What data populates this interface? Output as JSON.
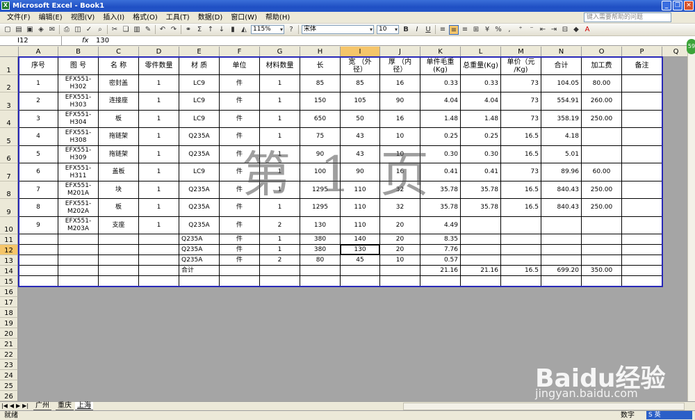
{
  "window": {
    "title": "Microsoft Excel - Book1"
  },
  "menu": {
    "items": [
      "文件(F)",
      "编辑(E)",
      "视图(V)",
      "插入(I)",
      "格式(O)",
      "工具(T)",
      "数据(D)",
      "窗口(W)",
      "帮助(H)"
    ],
    "help_placeholder": "键入需要帮助的问题"
  },
  "toolbar": {
    "zoom": "115%",
    "font": "宋体",
    "size": "10"
  },
  "formula_bar": {
    "cell_ref": "I12",
    "fx": "fx",
    "value": "130"
  },
  "columns": [
    "A",
    "B",
    "C",
    "D",
    "E",
    "F",
    "G",
    "H",
    "I",
    "J",
    "K",
    "L",
    "M",
    "N",
    "O",
    "P",
    "Q"
  ],
  "selected_column": "I",
  "rows": [
    "1",
    "2",
    "3",
    "4",
    "5",
    "6",
    "7",
    "8",
    "9",
    "10",
    "11",
    "12",
    "13",
    "14",
    "15",
    "16",
    "17",
    "18",
    "19",
    "20",
    "21",
    "22",
    "23",
    "24",
    "25",
    "26"
  ],
  "selected_row": "12",
  "table": {
    "headers": [
      "序号",
      "图 号",
      "名 称",
      "零件数量",
      "材 质",
      "单位",
      "材料数量",
      "长",
      "宽  （外\n径）",
      "厚  （内\n径）",
      "单件毛重\n(Kg)",
      "总重量(Kg)",
      "单价（元\n/Kg)",
      "合计",
      "加工费",
      "备注"
    ],
    "rows": [
      [
        "1",
        "EFX551-\nH302",
        "密封盖",
        "1",
        "LC9",
        "件",
        "1",
        "85",
        "85",
        "16",
        "0.33",
        "0.33",
        "73",
        "104.05",
        "80.00",
        ""
      ],
      [
        "2",
        "EFX551-\nH303",
        "连接座",
        "1",
        "LC9",
        "件",
        "1",
        "150",
        "105",
        "90",
        "4.04",
        "4.04",
        "73",
        "554.91",
        "260.00",
        ""
      ],
      [
        "3",
        "EFX551-\nH304",
        "板",
        "1",
        "LC9",
        "件",
        "1",
        "650",
        "50",
        "16",
        "1.48",
        "1.48",
        "73",
        "358.19",
        "250.00",
        ""
      ],
      [
        "4",
        "EFX551-\nH308",
        "拖链架",
        "1",
        "Q235A",
        "件",
        "1",
        "75",
        "43",
        "10",
        "0.25",
        "0.25",
        "16.5",
        "4.18",
        "",
        ""
      ],
      [
        "5",
        "EFX551-\nH309",
        "拖链架",
        "1",
        "Q235A",
        "件",
        "1",
        "90",
        "43",
        "10",
        "0.30",
        "0.30",
        "16.5",
        "5.01",
        "",
        ""
      ],
      [
        "6",
        "EFX551-\nH311",
        "盖板",
        "1",
        "LC9",
        "件",
        "1",
        "100",
        "90",
        "16",
        "0.41",
        "0.41",
        "73",
        "89.96",
        "60.00",
        ""
      ],
      [
        "7",
        "EFX551-\nM201A",
        "块",
        "1",
        "Q235A",
        "件",
        "1",
        "1295",
        "110",
        "32",
        "35.78",
        "35.78",
        "16.5",
        "840.43",
        "250.00",
        ""
      ],
      [
        "8",
        "EFX551-\nM202A",
        "板",
        "1",
        "Q235A",
        "件",
        "1",
        "1295",
        "110",
        "32",
        "35.78",
        "35.78",
        "16.5",
        "840.43",
        "250.00",
        ""
      ],
      [
        "9",
        "EFX551-\nM203A",
        "支座",
        "1",
        "Q235A",
        "件",
        "2",
        "130",
        "110",
        "20",
        "4.49",
        "",
        "",
        "",
        "",
        ""
      ],
      [
        "",
        "",
        "",
        "",
        "Q235A",
        "件",
        "1",
        "380",
        "140",
        "20",
        "8.35",
        "",
        "",
        "",
        "",
        ""
      ],
      [
        "",
        "",
        "",
        "",
        "Q235A",
        "件",
        "1",
        "380",
        "130",
        "20",
        "7.76",
        "",
        "",
        "",
        "",
        ""
      ],
      [
        "",
        "",
        "",
        "",
        "Q235A",
        "件",
        "2",
        "80",
        "45",
        "10",
        "0.57",
        "",
        "",
        "",
        "",
        ""
      ],
      [
        "",
        "",
        "",
        "",
        "合计",
        "",
        "",
        "",
        "",
        "",
        "21.16",
        "21.16",
        "16.5",
        "699.20",
        "350.00",
        ""
      ],
      [
        "",
        "",
        "",
        "",
        "",
        "",
        "",
        "",
        "",
        "",
        "",
        "",
        "",
        "",
        "",
        ""
      ]
    ]
  },
  "watermark": "第 1 页",
  "sheet_tabs": [
    "广州",
    "重庆",
    "上海"
  ],
  "active_tab": "上海",
  "status": {
    "ready": "就绪",
    "mode": "数字",
    "ime": "S 英"
  },
  "float_badge": "59",
  "site_watermark": {
    "brand": "Baidu经验",
    "url": "jingyan.baidu.com"
  }
}
